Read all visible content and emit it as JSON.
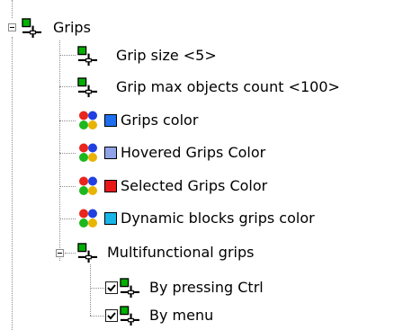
{
  "tree": {
    "root": {
      "label": "Grips",
      "icon": "grip-setting-icon",
      "expanded": true
    },
    "items": [
      {
        "label": "Grip size <5>",
        "icon": "grip-setting-icon"
      },
      {
        "label": "Grip max objects count <100>",
        "icon": "grip-setting-icon"
      },
      {
        "label": "Grips color",
        "icon": "color-setting-icon",
        "swatch": "#1e6ff0"
      },
      {
        "label": "Hovered Grips Color",
        "icon": "color-setting-icon",
        "swatch": "#8fa3e6"
      },
      {
        "label": "Selected Grips Color",
        "icon": "color-setting-icon",
        "swatch": "#e81818"
      },
      {
        "label": "Dynamic blocks grips color",
        "icon": "color-setting-icon",
        "swatch": "#19b4e8"
      },
      {
        "label": "Multifunctional grips",
        "icon": "grip-setting-icon",
        "expanded": true
      },
      {
        "label": "By pressing Ctrl",
        "icon": "grip-setting-icon",
        "checked": true
      },
      {
        "label": "By menu",
        "icon": "grip-setting-icon",
        "checked": true
      }
    ]
  },
  "colors": {
    "grip_green": "#00b000",
    "grip_black": "#000000",
    "dot_red": "#e8261e",
    "dot_green": "#1db81d",
    "dot_blue": "#2040e0"
  }
}
